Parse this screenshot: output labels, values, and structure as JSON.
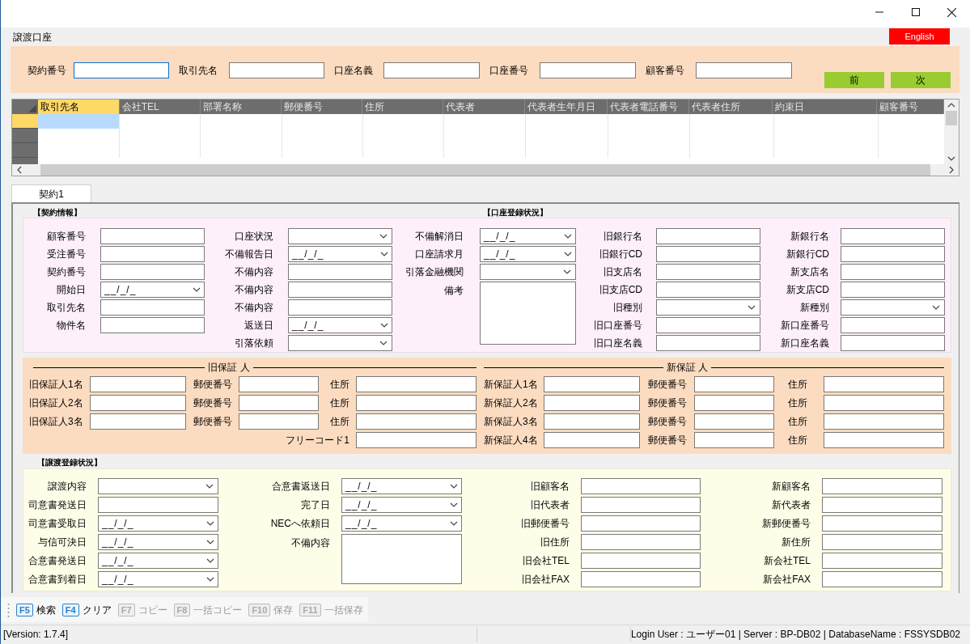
{
  "window": {
    "controls": [
      {
        "kind": "minimize"
      },
      {
        "kind": "maximize"
      },
      {
        "kind": "close"
      }
    ]
  },
  "form_title": "譲渡口座",
  "language_button": "English",
  "search": {
    "fields": [
      {
        "label": "契約番号",
        "focused": true
      },
      {
        "label": "取引先名",
        "focused": false
      },
      {
        "label": "口座名義",
        "focused": false
      },
      {
        "label": "口座番号",
        "focused": false
      },
      {
        "label": "顧客番号",
        "focused": false
      }
    ],
    "buttons": [
      "前",
      "次"
    ]
  },
  "grid": {
    "columns": [
      {
        "label": "取引先名",
        "selected": true
      },
      {
        "label": "会社TEL",
        "selected": false
      },
      {
        "label": "部署名称",
        "selected": false
      },
      {
        "label": "郵便番号",
        "selected": false
      },
      {
        "label": "住所",
        "selected": false
      },
      {
        "label": "代表者",
        "selected": false
      },
      {
        "label": "代表者生年月日",
        "selected": false
      },
      {
        "label": "代表者電話番号",
        "selected": false
      },
      {
        "label": "代表者住所",
        "selected": false
      },
      {
        "label": "約束日",
        "selected": false
      },
      {
        "label": "顧客番号",
        "selected": false
      }
    ],
    "rows": [
      {
        "selected": true
      },
      {
        "selected": false
      },
      {
        "selected": false
      }
    ]
  },
  "tabs": [
    {
      "label": "契約1",
      "selected": true
    }
  ],
  "contract_section": {
    "heading": "【契約情報】",
    "heading_2": "【口座登録状況】",
    "columns": [
      {
        "fields": [
          {
            "label": "顧客番号",
            "kind": "text"
          },
          {
            "label": "受注番号",
            "kind": "text"
          },
          {
            "label": "契約番号",
            "kind": "text"
          },
          {
            "label": "開始日",
            "kind": "date",
            "value": "__/_/_"
          },
          {
            "label": "取引先名",
            "kind": "text"
          },
          {
            "label": "物件名",
            "kind": "text"
          }
        ]
      },
      {
        "fields": [
          {
            "label": "口座状況",
            "kind": "select"
          },
          {
            "label": "不備報告日",
            "kind": "date",
            "value": "__/_/_"
          },
          {
            "label": "不備内容",
            "kind": "text"
          },
          {
            "label": "不備内容",
            "kind": "text"
          },
          {
            "label": "不備内容",
            "kind": "text"
          },
          {
            "label": "返送日",
            "kind": "date",
            "value": "__/_/_"
          },
          {
            "label": "引落依頼",
            "kind": "select"
          }
        ]
      },
      {
        "fields": [
          {
            "label": "不備解消日",
            "kind": "date",
            "value": "__/_/_"
          },
          {
            "label": "口座請求月",
            "kind": "date",
            "value": "__/_/_"
          },
          {
            "label": "引落金融機関",
            "kind": "select"
          },
          {
            "label": "備考",
            "kind": "memo"
          }
        ]
      },
      {
        "fields": [
          {
            "label": "旧銀行名",
            "kind": "text"
          },
          {
            "label": "旧銀行CD",
            "kind": "text"
          },
          {
            "label": "旧支店名",
            "kind": "text"
          },
          {
            "label": "旧支店CD",
            "kind": "text"
          },
          {
            "label": "旧種別",
            "kind": "select"
          },
          {
            "label": "旧口座番号",
            "kind": "text"
          },
          {
            "label": "旧口座名義",
            "kind": "text"
          }
        ]
      },
      {
        "fields": [
          {
            "label": "新銀行名",
            "kind": "text"
          },
          {
            "label": "新銀行CD",
            "kind": "text"
          },
          {
            "label": "新支店名",
            "kind": "text"
          },
          {
            "label": "新支店CD",
            "kind": "text"
          },
          {
            "label": "新種別",
            "kind": "select"
          },
          {
            "label": "新口座番号",
            "kind": "text"
          },
          {
            "label": "新口座名義",
            "kind": "text"
          }
        ]
      }
    ]
  },
  "guarantor_section": {
    "groups": [
      {
        "heading": "旧保証 人",
        "rows": [
          {
            "name": "旧保証人1名",
            "postal": "郵便番号",
            "address": "住所"
          },
          {
            "name": "旧保証人2名",
            "postal": "郵便番号",
            "address": "住所"
          },
          {
            "name": "旧保証人3名",
            "postal": "郵便番号",
            "address": "住所"
          }
        ],
        "extra_field": "フリーコード1"
      },
      {
        "heading": "新保証 人",
        "rows": [
          {
            "name": "新保証人1名",
            "postal": "郵便番号",
            "address": "住所"
          },
          {
            "name": "新保証人2名",
            "postal": "郵便番号",
            "address": "住所"
          },
          {
            "name": "新保証人3名",
            "postal": "郵便番号",
            "address": "住所"
          },
          {
            "name": "新保証人4名",
            "postal": "郵便番号",
            "address": "住所"
          }
        ]
      }
    ]
  },
  "transfer_section": {
    "heading": "【譲渡登録状況】",
    "columns": [
      {
        "fields": [
          {
            "label": "譲渡内容",
            "kind": "select"
          },
          {
            "label": "司意書発送日",
            "kind": "text"
          },
          {
            "label": "司意書受取日",
            "kind": "date",
            "value": "__/_/_"
          },
          {
            "label": "与信可決日",
            "kind": "date",
            "value": "__/_/_"
          },
          {
            "label": "合意書発送日",
            "kind": "date",
            "value": "__/_/_"
          },
          {
            "label": "合意書到着日",
            "kind": "date",
            "value": "__/_/_"
          }
        ]
      },
      {
        "fields": [
          {
            "label": "合意書返送日",
            "kind": "date",
            "value": "__/_/_"
          },
          {
            "label": "完了日",
            "kind": "date",
            "value": "__/_/_"
          },
          {
            "label": "NECへ依頼日",
            "kind": "date",
            "value": "__/_/_"
          },
          {
            "label": "不備内容",
            "kind": "memo"
          }
        ]
      },
      {
        "fields": [
          {
            "label": "旧顧客名",
            "kind": "text"
          },
          {
            "label": "旧代表者",
            "kind": "text"
          },
          {
            "label": "旧郵便番号",
            "kind": "text"
          },
          {
            "label": "旧住所",
            "kind": "text"
          },
          {
            "label": "旧会社TEL",
            "kind": "text"
          },
          {
            "label": "旧会社FAX",
            "kind": "text"
          }
        ]
      },
      {
        "fields": [
          {
            "label": "新顧客名",
            "kind": "text"
          },
          {
            "label": "新代表者",
            "kind": "text"
          },
          {
            "label": "新郵便番号",
            "kind": "text"
          },
          {
            "label": "新住所",
            "kind": "text"
          },
          {
            "label": "新会社TEL",
            "kind": "text"
          },
          {
            "label": "新会社FAX",
            "kind": "text"
          }
        ]
      }
    ]
  },
  "function_keys": [
    {
      "key": "F5",
      "label": "検索",
      "disabled": false
    },
    {
      "key": "F4",
      "label": "クリア",
      "disabled": false
    },
    {
      "key": "F7",
      "label": "コピー",
      "disabled": true
    },
    {
      "key": "F8",
      "label": "一括コピー",
      "disabled": true
    },
    {
      "key": "F10",
      "label": "保存",
      "disabled": true
    },
    {
      "key": "F11",
      "label": "一括保存",
      "disabled": true
    }
  ],
  "status_bar": {
    "version": "[Version: 1.7.4]",
    "info": "Login User : ユーザー01 | Server : BP-DB02 | DatabaseName : FSSYSDB02"
  }
}
